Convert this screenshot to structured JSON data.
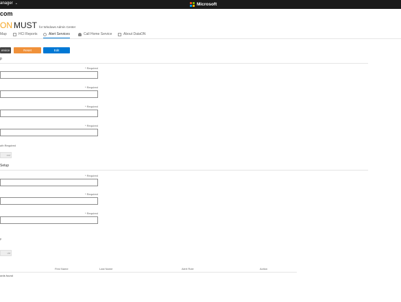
{
  "topbar": {
    "app_label": "anager",
    "brand_text": "Microsoft",
    "logo_colors": [
      "#f25022",
      "#7fba00",
      "#00a4ef",
      "#ffb900"
    ]
  },
  "header": {
    "domain": "com",
    "brand_on": "ON",
    "brand_must": "MUST",
    "brand_sub": "for Windows Admin Center",
    "accent_color": "#f5a623"
  },
  "tabs": [
    {
      "label": "Map",
      "icon": "map-icon"
    },
    {
      "label": "HCI Reports",
      "icon": "report-icon"
    },
    {
      "label": "Alert Services",
      "icon": "alert-icon",
      "active": true
    },
    {
      "label": "Call Home Service",
      "icon": "person-icon"
    },
    {
      "label": "About DataON",
      "icon": "info-icon"
    }
  ],
  "toolbar": {
    "service_label": "ervice",
    "reset_label": "Reset",
    "edit_label": "Edit",
    "reset_color": "#f0913a",
    "edit_color": "#0078d4"
  },
  "smtp": {
    "title": "p",
    "required_label": "* Required",
    "auth_note": "uth Required",
    "button_label": "est"
  },
  "recipients": {
    "title": "Setup",
    "required_label": "* Required",
    "small_label": "p",
    "button_label": "dd"
  },
  "table": {
    "columns": [
      "First Name",
      "Last Name",
      "Alert Role",
      "Action"
    ],
    "empty_text": "ords found"
  }
}
